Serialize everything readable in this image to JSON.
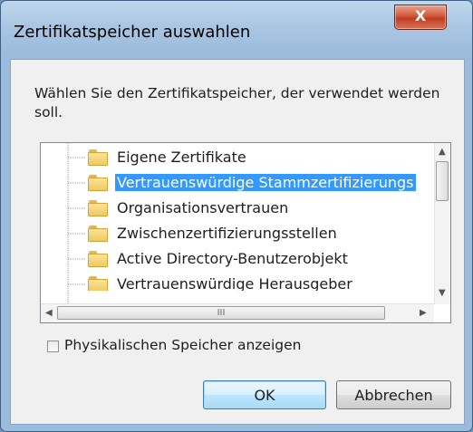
{
  "window": {
    "title": "Zertifikatspeicher auswahlen",
    "close_label": "X"
  },
  "prompt": "Wählen Sie den Zertifikatspeicher, der verwendet werden soll.",
  "tree": {
    "items": [
      {
        "label": "Eigene Zertifikate",
        "selected": false
      },
      {
        "label": "Vertrauenswürdige Stammzertifizierungs",
        "selected": true
      },
      {
        "label": "Organisationsvertrauen",
        "selected": false
      },
      {
        "label": "Zwischenzertifizierungsstellen",
        "selected": false
      },
      {
        "label": "Active Directory-Benutzerobjekt",
        "selected": false
      },
      {
        "label": "Vertrauenswürdige Herausgeber",
        "selected": false
      }
    ],
    "hscroll_grip": "III"
  },
  "checkbox": {
    "label": "Physikalischen Speicher anzeigen",
    "checked": false
  },
  "buttons": {
    "ok": "OK",
    "cancel": "Abbrechen"
  }
}
